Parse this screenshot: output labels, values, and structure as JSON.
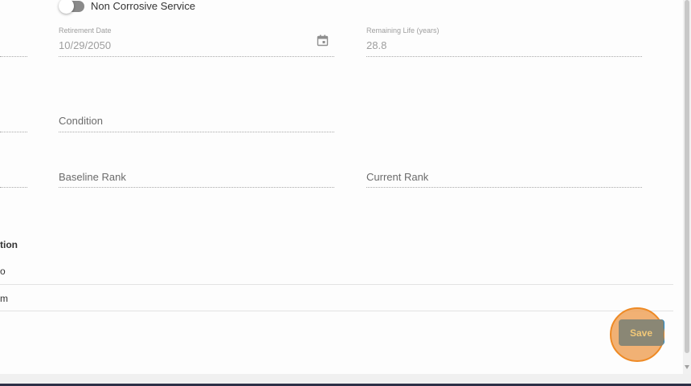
{
  "toggle": {
    "label": "Non Corrosive Service",
    "on": false
  },
  "retirement_date": {
    "label": "Retirement Date",
    "value": "10/29/2050"
  },
  "remaining_life": {
    "label": "Remaining Life (years)",
    "value": "28.8"
  },
  "condition": {
    "placeholder": "Condition"
  },
  "baseline_rank": {
    "placeholder": "Baseline Rank"
  },
  "current_rank": {
    "placeholder": "Current Rank"
  },
  "section": {
    "header": "tion",
    "rows": [
      "o",
      "m"
    ]
  },
  "actions": {
    "save_label": "Save"
  },
  "colors": {
    "save_bg": "#8a8775",
    "save_text": "#f2c878",
    "highlight": "#ee8a25",
    "accent_blue": "#1e88c8"
  }
}
